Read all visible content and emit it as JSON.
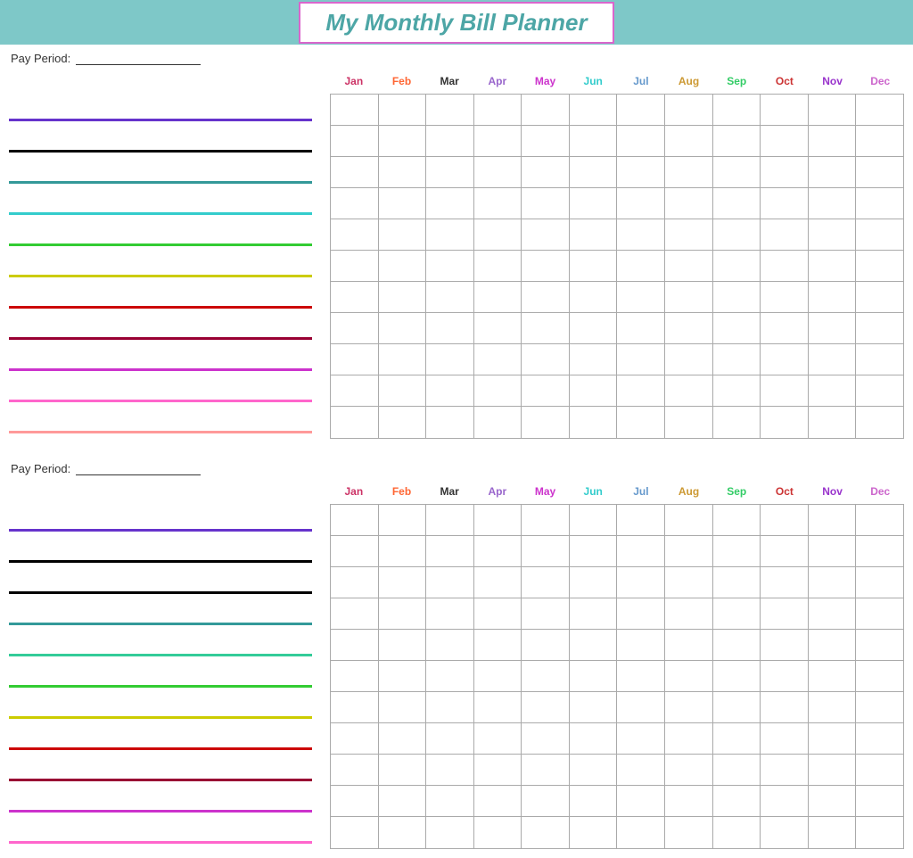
{
  "header": {
    "title": "My Monthly Bill Planner"
  },
  "section1": {
    "pay_period_label": "Pay Period:",
    "months": [
      {
        "label": "Jan",
        "color": "#cc3366"
      },
      {
        "label": "Feb",
        "color": "#ff6633"
      },
      {
        "label": "Mar",
        "color": "#333333"
      },
      {
        "label": "Apr",
        "color": "#9966cc"
      },
      {
        "label": "May",
        "color": "#cc33cc"
      },
      {
        "label": "Jun",
        "color": "#33cccc"
      },
      {
        "label": "Jul",
        "color": "#6699cc"
      },
      {
        "label": "Aug",
        "color": "#cc9933"
      },
      {
        "label": "Sep",
        "color": "#33cc66"
      },
      {
        "label": "Oct",
        "color": "#cc3333"
      },
      {
        "label": "Nov",
        "color": "#9933cc"
      },
      {
        "label": "Dec",
        "color": "#cc66cc"
      }
    ],
    "rows": 11
  },
  "section2": {
    "pay_period_label": "Pay Period:",
    "months": [
      {
        "label": "Jan",
        "color": "#cc3366"
      },
      {
        "label": "Feb",
        "color": "#ff6633"
      },
      {
        "label": "Mar",
        "color": "#333333"
      },
      {
        "label": "Apr",
        "color": "#9966cc"
      },
      {
        "label": "May",
        "color": "#cc33cc"
      },
      {
        "label": "Jun",
        "color": "#33cccc"
      },
      {
        "label": "Jul",
        "color": "#6699cc"
      },
      {
        "label": "Aug",
        "color": "#cc9933"
      },
      {
        "label": "Sep",
        "color": "#33cc66"
      },
      {
        "label": "Oct",
        "color": "#cc3333"
      },
      {
        "label": "Nov",
        "color": "#9933cc"
      },
      {
        "label": "Dec",
        "color": "#cc66cc"
      }
    ],
    "rows": 11
  }
}
